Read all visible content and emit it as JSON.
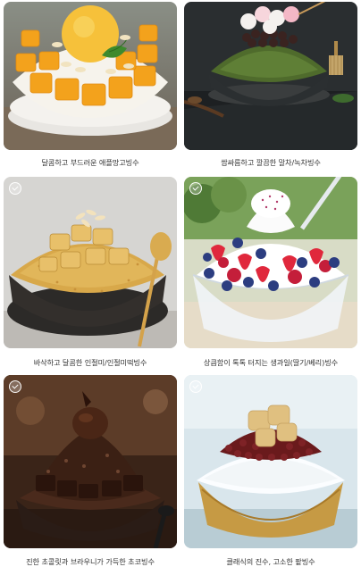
{
  "items": [
    {
      "caption": "달콤하고 부드러운 애플망고빙수",
      "icon": "mango-bingsu",
      "selectable": false
    },
    {
      "caption": "쌉싸름하고 깔끔한 말차/녹차빙수",
      "icon": "matcha-bingsu",
      "selectable": false
    },
    {
      "caption": "바삭하고 달콤한 인절미/인절미떡빙수",
      "icon": "injeolmi-bingsu",
      "selectable": true
    },
    {
      "caption": "상큼함이 톡톡 터지는 생과일(딸기/베리)빙수",
      "icon": "berry-bingsu",
      "selectable": true
    },
    {
      "caption": "진한 초콜릿과 브라우니가 가득한 초코빙수",
      "icon": "chocolate-bingsu",
      "selectable": true
    },
    {
      "caption": "클래식의 진수, 고소한 팥빙수",
      "icon": "patbingsu",
      "selectable": true
    }
  ],
  "colors": {
    "caption_text": "#333333",
    "background": "#ffffff"
  }
}
